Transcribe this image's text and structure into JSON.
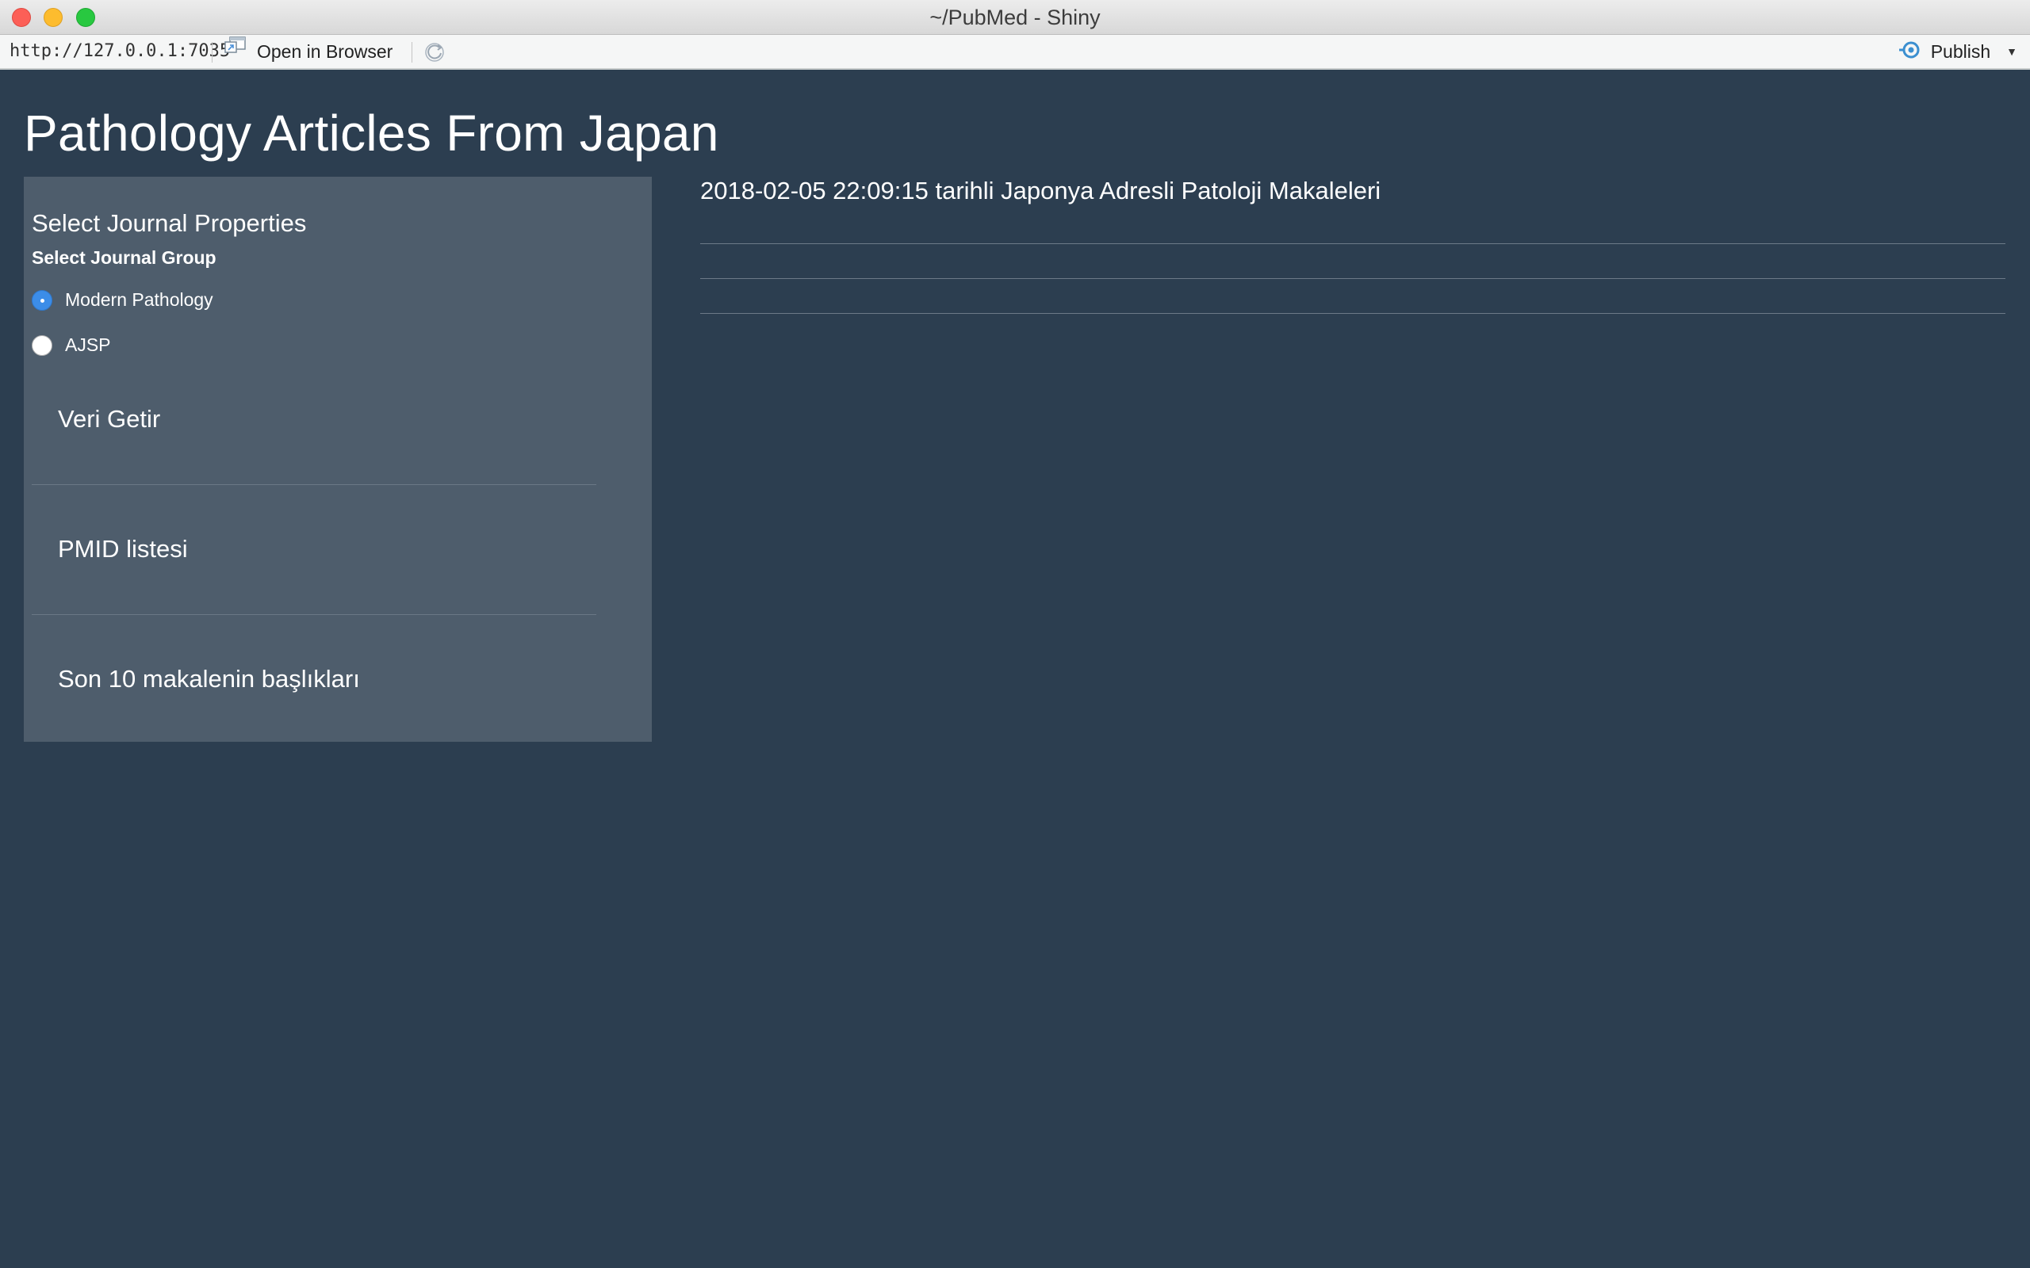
{
  "window": {
    "title": "~/PubMed - Shiny"
  },
  "toolbar": {
    "url": "http://127.0.0.1:7035",
    "open_in_browser": "Open in Browser",
    "publish": "Publish"
  },
  "app": {
    "title": "Pathology Articles From Japan",
    "sidebar": {
      "heading": "Select Journal Properties",
      "group_label": "Select Journal Group",
      "options": [
        {
          "label": "Modern Pathology",
          "selected": true
        },
        {
          "label": "AJSP",
          "selected": false
        }
      ],
      "sections": [
        "Veri Getir",
        "PMID listesi",
        "Son 10 makalenin başlıkları"
      ]
    },
    "main": {
      "heading": "2018-02-05 22:09:15 tarihli Japonya Adresli Patoloji Makaleleri"
    }
  },
  "colors": {
    "background": "#2c3e50",
    "sidebar": "#4e5d6c",
    "radio_accent": "#3c8de8"
  }
}
